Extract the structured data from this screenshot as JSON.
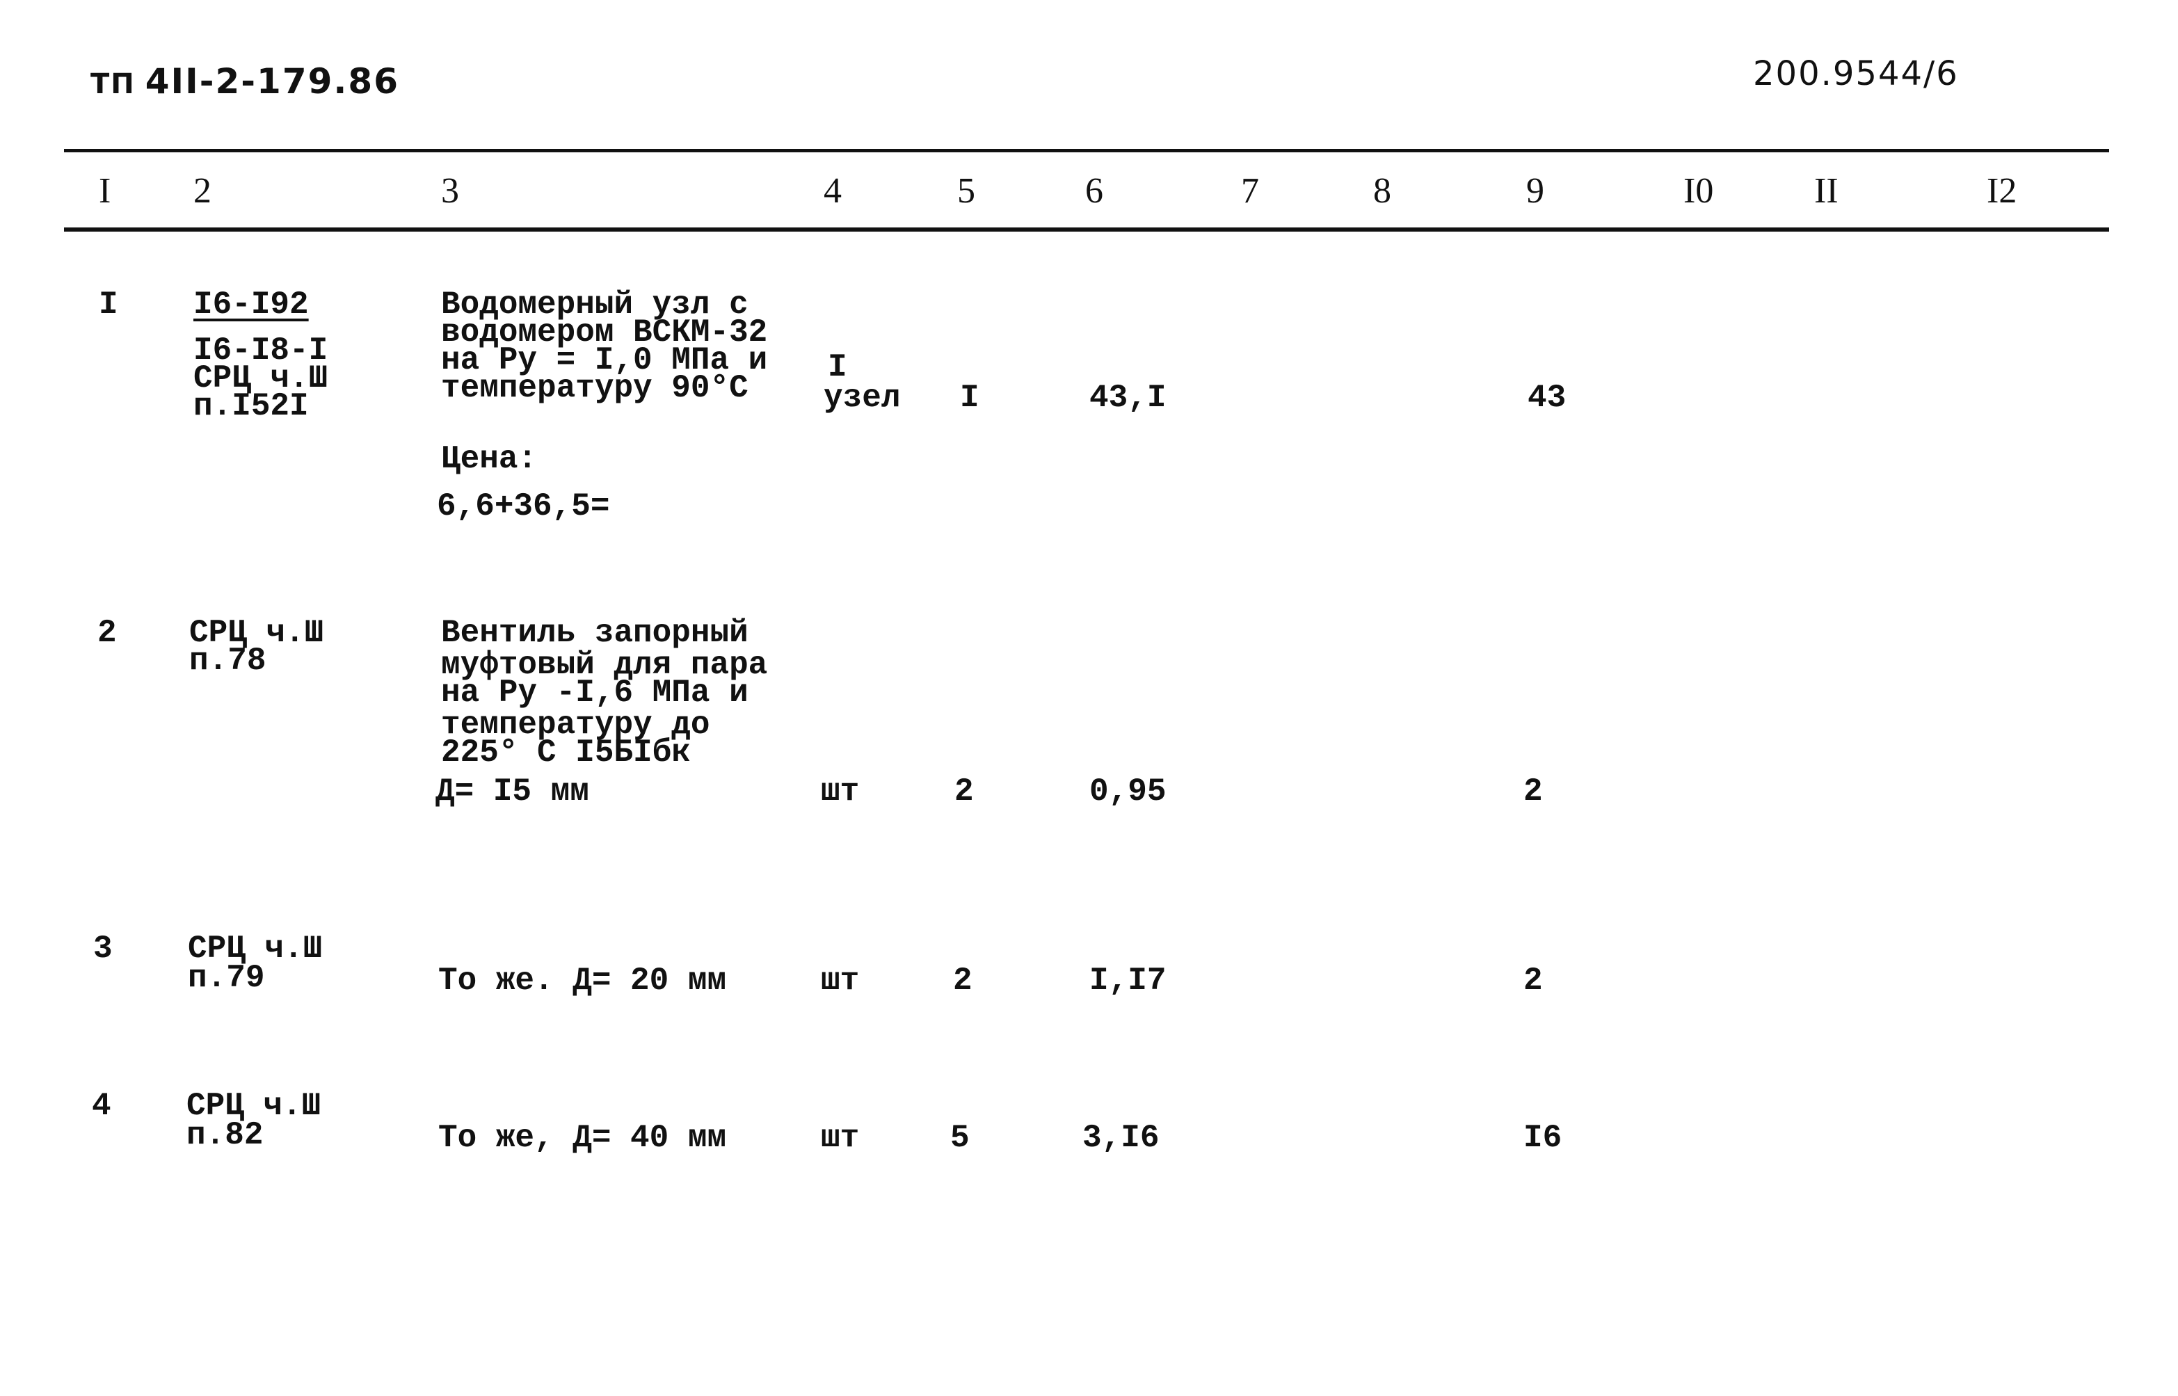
{
  "document": {
    "code_prefix": "ТП",
    "code": "4II-2-179.86",
    "sheet_code": "200.9544/6"
  },
  "table": {
    "column_headers": [
      "I",
      "2",
      "3",
      "4",
      "5",
      "6",
      "7",
      "8",
      "9",
      "I0",
      "II",
      "I2"
    ],
    "rows": [
      {
        "num": "I",
        "ref_underlined": "I6-I92",
        "ref_lines": [
          "I6-I8-I",
          "СРЦ ч.Ш",
          "п.I52I"
        ],
        "description_lines": [
          "Водомерный узл с",
          "водомером ВСКМ-32",
          "на Ру = I,0 МПа и",
          "температуру 90°С"
        ],
        "price_label": "Цена:",
        "price_formula": "6,6+36,5=",
        "unit_qty_line": "I",
        "unit": "узел",
        "qty": "I",
        "col6": "43,I",
        "col9": "43"
      },
      {
        "num": "2",
        "ref_lines": [
          "СРЦ ч.Ш",
          "п.78"
        ],
        "description_lines": [
          "Вентиль запорный",
          "муфтовый для пара",
          "на Ру -I,6 МПа и",
          "температуру до",
          "225° С I5БIбк",
          "Д= I5 мм"
        ],
        "unit": "шт",
        "qty": "2",
        "col6": "0,95",
        "col9": "2"
      },
      {
        "num": "3",
        "ref_lines": [
          "СРЦ ч.Ш",
          "п.79"
        ],
        "description_lines": [
          "То же. Д= 20 мм"
        ],
        "unit": "шт",
        "qty": "2",
        "col6": "I,I7",
        "col9": "2"
      },
      {
        "num": "4",
        "ref_lines": [
          "СРЦ ч.Ш",
          "п.82"
        ],
        "description_lines": [
          "То же, Д= 40 мм"
        ],
        "unit": "шт",
        "qty": "5",
        "col6": "3,I6",
        "col9": "I6"
      }
    ]
  }
}
